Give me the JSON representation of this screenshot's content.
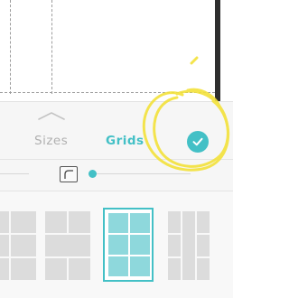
{
  "colors": {
    "accent": "#43c0c6",
    "accent_light": "#8ed8dc",
    "inactive_text": "#b0b0b0",
    "highlight": "#f3e23a"
  },
  "tabs": [
    {
      "label": "Sizes",
      "active": false
    },
    {
      "label": "Grids",
      "active": true
    }
  ],
  "icons": {
    "collapse": "chevron-up-icon",
    "confirm": "checkmark-icon",
    "corner": "corner-radius-icon"
  },
  "slider": {
    "name": "corner-radius-slider"
  },
  "layouts": {
    "selected_index": 2,
    "items": [
      "layout-1",
      "layout-2",
      "layout-3",
      "layout-4"
    ]
  }
}
